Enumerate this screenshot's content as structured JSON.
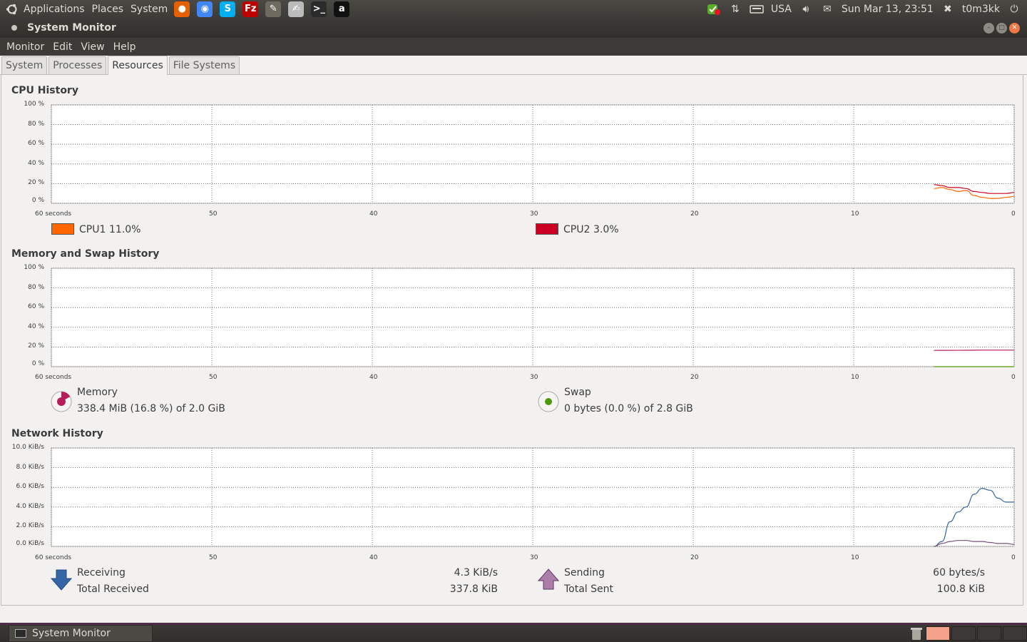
{
  "top_panel": {
    "menus": [
      "Applications",
      "Places",
      "System"
    ],
    "launchers": [
      {
        "name": "firefox-icon",
        "glyph": "●",
        "color": "#e66000"
      },
      {
        "name": "chrome-icon",
        "glyph": "◉",
        "color": "#4285f4"
      },
      {
        "name": "skype-icon",
        "glyph": "S",
        "color": "#00aff0"
      },
      {
        "name": "filezilla-icon",
        "glyph": "Fz",
        "color": "#bf0000"
      },
      {
        "name": "gimp-icon",
        "glyph": "✎",
        "color": "#6f6a5f"
      },
      {
        "name": "text-editor-icon",
        "glyph": "✍",
        "color": "#bbbbbb"
      },
      {
        "name": "terminal-icon",
        "glyph": ">_",
        "color": "#2b2b2b"
      },
      {
        "name": "amarok-icon",
        "glyph": "a",
        "color": "#111111"
      }
    ],
    "keyboard_layout": "USA",
    "datetime": "Sun Mar 13, 23:51",
    "user": "t0m3kk"
  },
  "window": {
    "title": "System Monitor",
    "menu": [
      "Monitor",
      "Edit",
      "View",
      "Help"
    ],
    "tabs": [
      {
        "label": "System",
        "active": false
      },
      {
        "label": "Processes",
        "active": false
      },
      {
        "label": "Resources",
        "active": true
      },
      {
        "label": "File Systems",
        "active": false
      }
    ]
  },
  "cpu": {
    "title": "CPU History",
    "y_ticks": [
      "100 %",
      "80 %",
      "60 %",
      "40 %",
      "20 %",
      "0 %"
    ],
    "x_ticks": [
      "60 seconds",
      "50",
      "40",
      "30",
      "20",
      "10",
      "0"
    ],
    "legend": [
      {
        "label": "CPU1",
        "value": "11.0%",
        "color": "#ff6600"
      },
      {
        "label": "CPU2",
        "value": "3.0%",
        "color": "#cc0022"
      }
    ]
  },
  "memory": {
    "title": "Memory and Swap History",
    "y_ticks": [
      "100 %",
      "80 %",
      "60 %",
      "40 %",
      "20 %",
      "0 %"
    ],
    "x_ticks": [
      "60 seconds",
      "50",
      "40",
      "30",
      "20",
      "10",
      "0"
    ],
    "memory_label": "Memory",
    "memory_value": "338.4 MiB (16.8 %) of 2.0 GiB",
    "memory_color": "#b51d5a",
    "swap_label": "Swap",
    "swap_value": "0 bytes (0.0 %) of 2.8 GiB",
    "swap_color": "#4e9a06"
  },
  "network": {
    "title": "Network History",
    "y_ticks": [
      "10.0 KiB/s",
      "8.0 KiB/s",
      "6.0 KiB/s",
      "4.0 KiB/s",
      "2.0 KiB/s",
      "0.0 KiB/s"
    ],
    "x_ticks": [
      "60 seconds",
      "50",
      "40",
      "30",
      "20",
      "10",
      "0"
    ],
    "receiving_label": "Receiving",
    "receiving_value": "4.3 KiB/s",
    "total_received_label": "Total Received",
    "total_received_value": "337.8 KiB",
    "sending_label": "Sending",
    "sending_value": "60 bytes/s",
    "total_sent_label": "Total Sent",
    "total_sent_value": "100.8 KiB",
    "receiving_color": "#3465a4",
    "sending_color": "#75507b"
  },
  "chart_data": [
    {
      "type": "line",
      "title": "CPU History",
      "ylim": [
        0,
        100
      ],
      "xlim": [
        60,
        0
      ],
      "series": [
        {
          "name": "CPU1",
          "color": "#ff6600",
          "x": [
            5,
            4.5,
            4,
            3.5,
            3,
            2.5,
            2,
            1.5,
            1,
            0.5,
            0
          ],
          "y": [
            15,
            16,
            14,
            12,
            13,
            8,
            6,
            5,
            5,
            6,
            7
          ]
        },
        {
          "name": "CPU2",
          "color": "#cc0022",
          "x": [
            5,
            4.5,
            4,
            3.5,
            3,
            2.5,
            2,
            1.5,
            1,
            0.5,
            0
          ],
          "y": [
            19,
            18,
            16,
            16,
            15,
            12,
            11,
            10,
            10,
            10,
            11
          ]
        }
      ]
    },
    {
      "type": "line",
      "title": "Memory and Swap History",
      "ylim": [
        0,
        100
      ],
      "xlim": [
        60,
        0
      ],
      "series": [
        {
          "name": "Memory",
          "color": "#b51d5a",
          "x": [
            5,
            4,
            3,
            2,
            1,
            0
          ],
          "y": [
            16.5,
            16.6,
            16.7,
            16.8,
            16.8,
            16.8
          ]
        },
        {
          "name": "Swap",
          "color": "#4e9a06",
          "x": [
            5,
            4,
            3,
            2,
            1,
            0
          ],
          "y": [
            0,
            0,
            0,
            0,
            0,
            0
          ]
        }
      ]
    },
    {
      "type": "line",
      "title": "Network History",
      "ylim": [
        0,
        10
      ],
      "xlim": [
        60,
        0
      ],
      "series": [
        {
          "name": "Receiving",
          "color": "#3465a4",
          "x": [
            5,
            4.5,
            4,
            3.5,
            3,
            2.5,
            2,
            1.5,
            1,
            0.5,
            0
          ],
          "y": [
            0,
            0.5,
            2.5,
            3.5,
            4.0,
            5.3,
            5.9,
            5.7,
            4.9,
            4.5,
            4.5
          ]
        },
        {
          "name": "Sending",
          "color": "#75507b",
          "x": [
            5,
            4.5,
            4,
            3.5,
            3,
            2.5,
            2,
            1.5,
            1,
            0.5,
            0
          ],
          "y": [
            0,
            0.3,
            0.5,
            0.6,
            0.6,
            0.5,
            0.5,
            0.4,
            0.3,
            0.3,
            0.2
          ]
        }
      ]
    }
  ]
}
